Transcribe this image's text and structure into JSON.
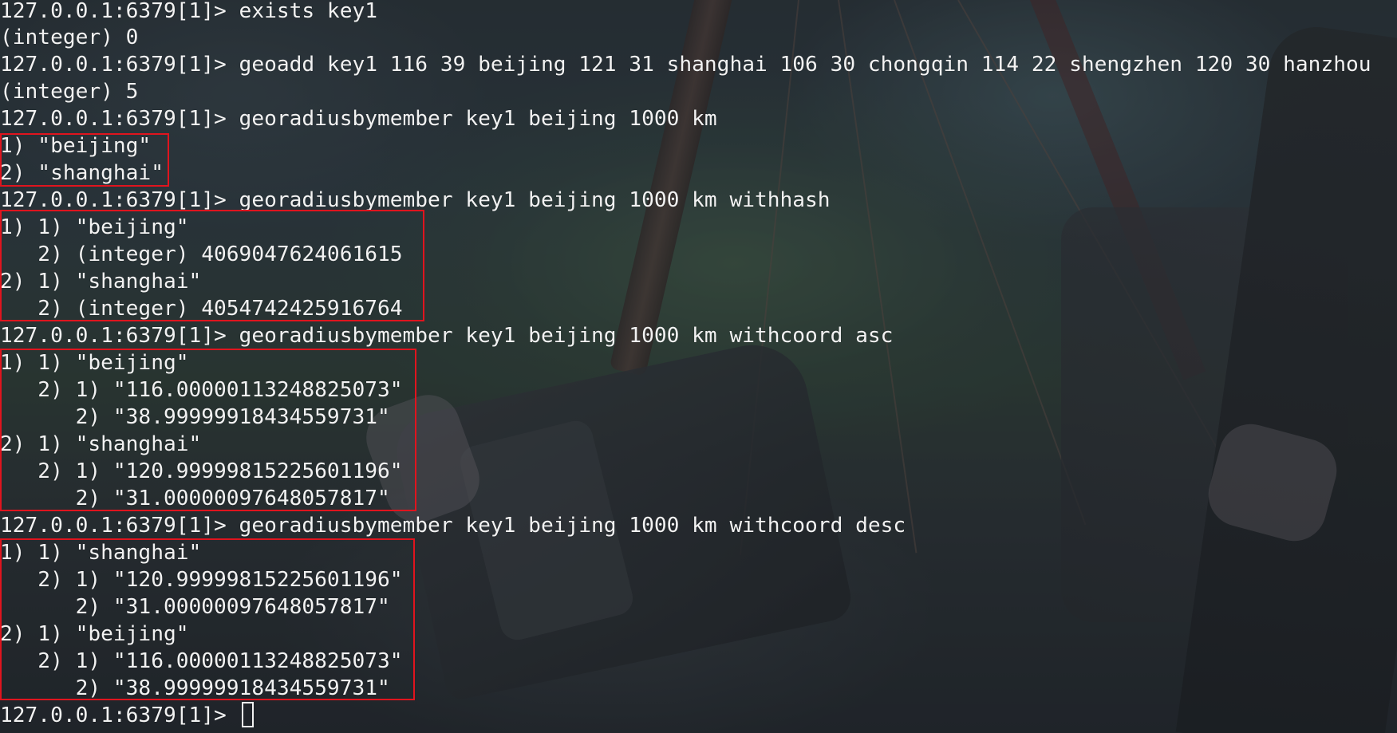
{
  "terminal": {
    "lines": [
      "127.0.0.1:6379[1]> exists key1",
      "(integer) 0",
      "127.0.0.1:6379[1]> geoadd key1 116 39 beijing 121 31 shanghai 106 30 chongqin 114 22 shengzhen 120 30 hanzhou",
      "(integer) 5",
      "127.0.0.1:6379[1]> georadiusbymember key1 beijing 1000 km",
      "1) \"beijing\"",
      "2) \"shanghai\"",
      "127.0.0.1:6379[1]> georadiusbymember key1 beijing 1000 km withhash",
      "1) 1) \"beijing\"",
      "   2) (integer) 4069047624061615",
      "2) 1) \"shanghai\"",
      "   2) (integer) 4054742425916764",
      "127.0.0.1:6379[1]> georadiusbymember key1 beijing 1000 km withcoord asc",
      "1) 1) \"beijing\"",
      "   2) 1) \"116.00000113248825073\"",
      "      2) \"38.99999918434559731\"",
      "2) 1) \"shanghai\"",
      "   2) 1) \"120.99999815225601196\"",
      "      2) \"31.00000097648057817\"",
      "127.0.0.1:6379[1]> georadiusbymember key1 beijing 1000 km withcoord desc",
      "1) 1) \"shanghai\"",
      "   2) 1) \"120.99999815225601196\"",
      "      2) \"31.00000097648057817\"",
      "2) 1) \"beijing\"",
      "   2) 1) \"116.00000113248825073\"",
      "      2) \"38.99999918434559731\"",
      "127.0.0.1:6379[1]> "
    ]
  },
  "colors": {
    "text": "#f2f2f2",
    "highlight_box": "#e0141e"
  }
}
